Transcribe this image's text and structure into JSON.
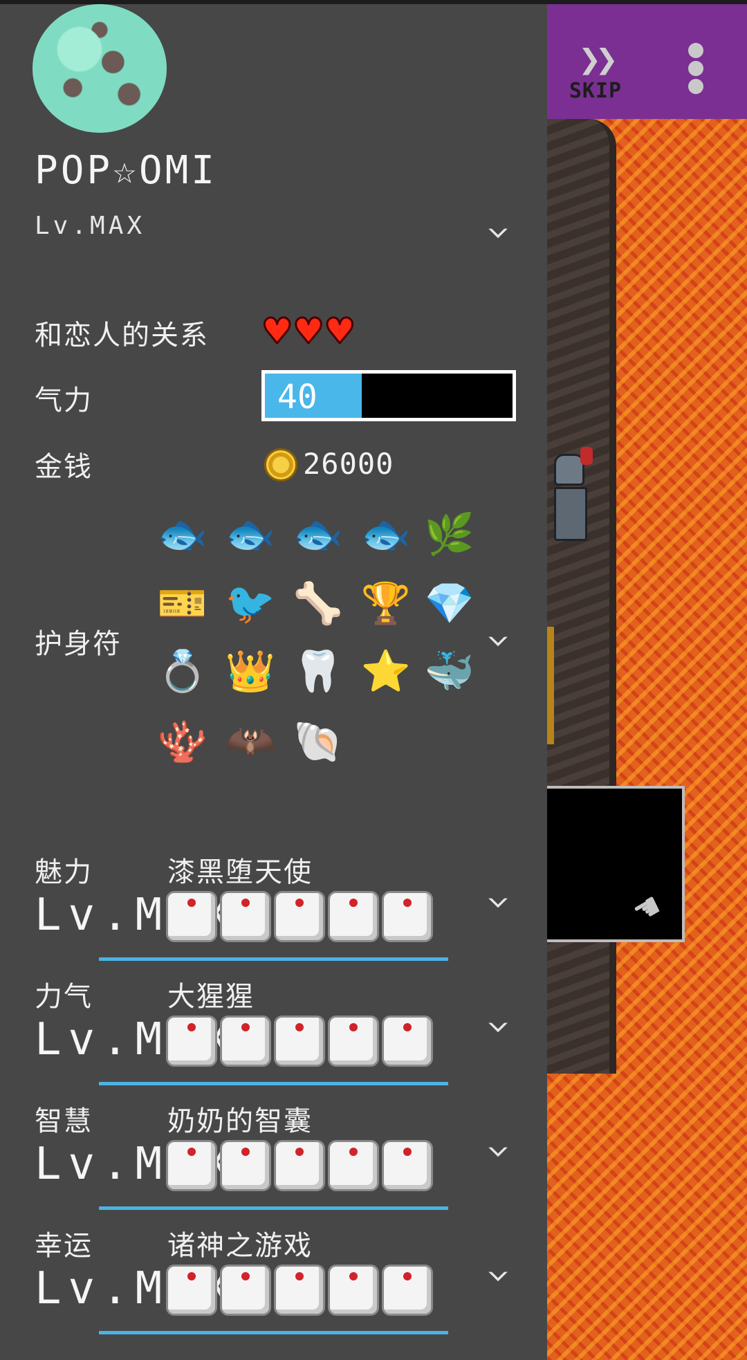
{
  "player": {
    "name": "POP☆OMI",
    "level": "Lv.MAX"
  },
  "relationship": {
    "label": "和恋人的关系",
    "hearts": 3
  },
  "energy": {
    "label": "气力",
    "value": "40",
    "fraction": 0.39
  },
  "money": {
    "label": "金钱",
    "amount": "26000"
  },
  "charms": {
    "label": "护身符"
  },
  "attributes": [
    {
      "name": "魅力",
      "title": "漆黑堕天使",
      "level": "Lv.MAX"
    },
    {
      "name": "力气",
      "title": "大猩猩",
      "level": "Lv.MAX"
    },
    {
      "name": "智慧",
      "title": "奶奶的智囊",
      "level": "Lv.MAX"
    },
    {
      "name": "幸运",
      "title": "诸神之游戏",
      "level": "Lv.MAX"
    }
  ],
  "game": {
    "skip_label": "SKIP"
  },
  "colors": {
    "panel": "#474747",
    "header": "#7b2f93",
    "energy_fill": "#4ab7ea",
    "underline": "#4ab4e4",
    "heart": "#ff2a14"
  }
}
